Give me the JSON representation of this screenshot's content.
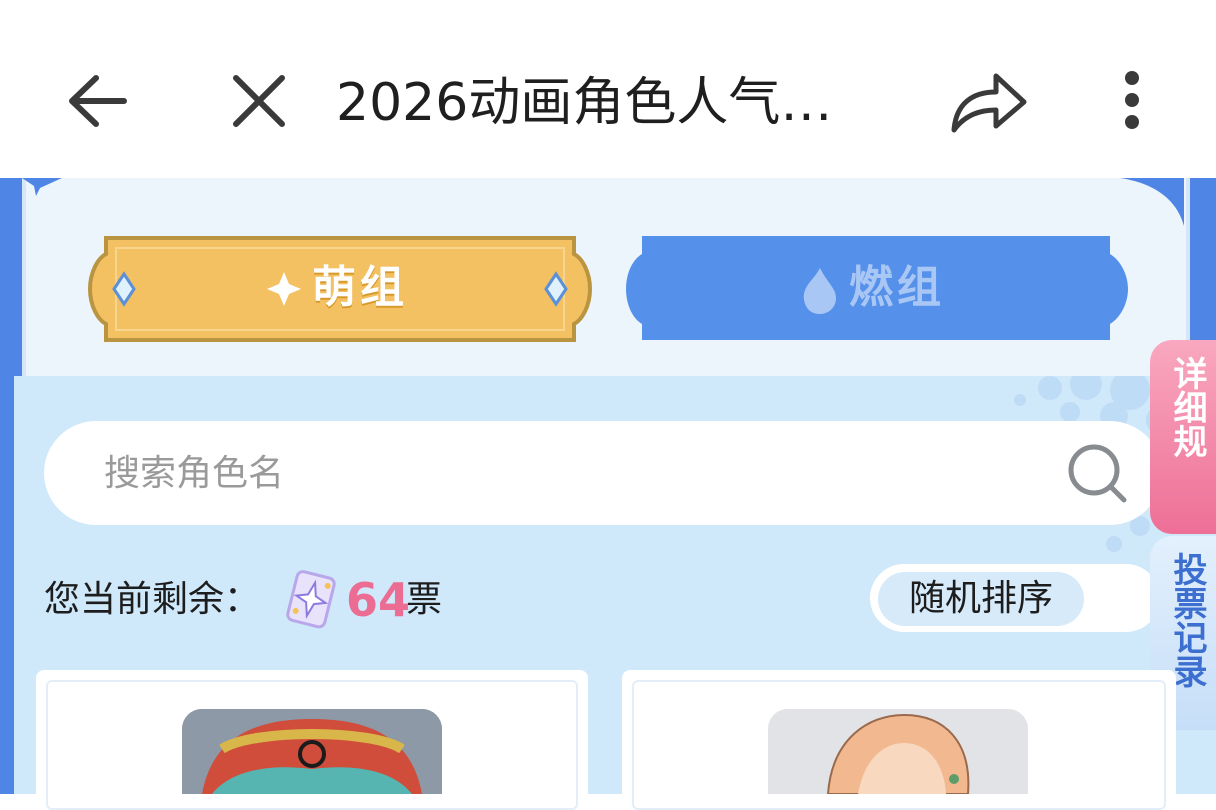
{
  "topbar": {
    "title": "2026动画角色人气…",
    "icons": [
      "back-arrow-icon",
      "close-icon",
      "share-icon",
      "more-vertical-icon"
    ]
  },
  "tabs": [
    {
      "label": "萌组",
      "icon": "sparkle-icon",
      "active": true
    },
    {
      "label": "燃组",
      "icon": "flame-icon",
      "active": false
    }
  ],
  "search": {
    "placeholder": "搜索角色名",
    "value": ""
  },
  "votes": {
    "label": "您当前剩余：",
    "count": "64",
    "unit": "票"
  },
  "sort": {
    "label": "随机排序"
  },
  "side_buttons": {
    "rules": "详细规",
    "record": "投票记录"
  },
  "colors": {
    "frame_blue": "#4f86e6",
    "panel_blue": "#cfe8fa",
    "gold": "#f3c062",
    "pink": "#ec6d94"
  }
}
